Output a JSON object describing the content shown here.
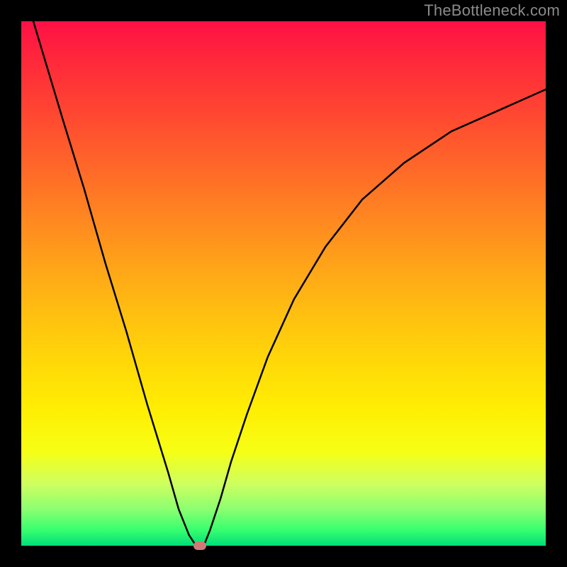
{
  "watermark": "TheBottleneck.com",
  "chart_data": {
    "type": "line",
    "title": "",
    "xlabel": "",
    "ylabel": "",
    "xlim": [
      0,
      100
    ],
    "ylim": [
      0,
      100
    ],
    "grid": false,
    "x": [
      0,
      2,
      5,
      8,
      12,
      16,
      20,
      24,
      28,
      30,
      32,
      33,
      34,
      35,
      36,
      38,
      40,
      43,
      47,
      52,
      58,
      65,
      73,
      82,
      91,
      100
    ],
    "values": [
      108,
      101,
      91,
      81,
      68,
      54,
      41,
      27,
      14,
      7,
      2,
      0.5,
      0,
      0.5,
      3,
      9,
      16,
      25,
      36,
      47,
      57,
      66,
      73,
      79,
      83,
      87
    ],
    "min_point": {
      "x": 34,
      "y": 0
    },
    "background_gradient": {
      "top": "#ff1045",
      "mid": "#ffd808",
      "bottom": "#00de78"
    }
  }
}
